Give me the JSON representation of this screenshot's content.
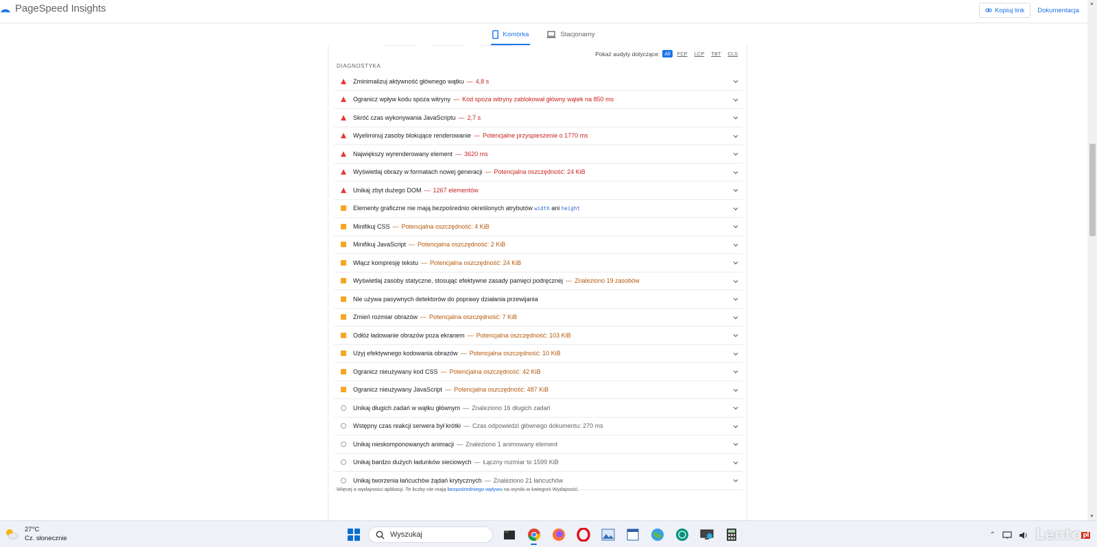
{
  "header": {
    "brand": "PageSpeed Insights",
    "copy_link": "Kopiuj link",
    "docs": "Dokumentacja"
  },
  "device_tabs": [
    {
      "label": "Komórka",
      "active": true
    },
    {
      "label": "Stacjonarny",
      "active": false
    }
  ],
  "filter": {
    "label": "Pokaż audyty dotyczące:",
    "chips": [
      "All",
      "FCP",
      "LCP",
      "TBT",
      "CLS"
    ],
    "active": "All"
  },
  "section_title": "DIAGNOSTYKA",
  "audits": [
    {
      "status": "fail",
      "title": "Zminimalizuj aktywność głównego wątku",
      "value": "4,8 s"
    },
    {
      "status": "fail",
      "title": "Ogranicz wpływ kodu spoza witryny",
      "value": "Kod spoza witryny zablokował główny wątek na 850 ms"
    },
    {
      "status": "fail",
      "title": "Skróć czas wykonywania JavaScriptu",
      "value": "2,7 s"
    },
    {
      "status": "fail",
      "title": "Wyeliminuj zasoby blokujące renderowanie",
      "value": "Potencjalne przyspieszenie o 1770 ms"
    },
    {
      "status": "fail",
      "title": "Największy wyrenderowany element",
      "value": "3620 ms"
    },
    {
      "status": "fail",
      "title": "Wyświetlaj obrazy w formatach nowej generacji",
      "value": "Potencjalna oszczędność: 24 KiB"
    },
    {
      "status": "fail",
      "title": "Unikaj zbyt dużego DOM",
      "value": "1267 elementów"
    },
    {
      "status": "avg",
      "title": "Elementy graficzne nie mają bezpośrednio określonych atrybutów",
      "code1": "width",
      "conj": "ani",
      "code2": "height"
    },
    {
      "status": "avg",
      "title": "Minifikuj CSS",
      "value": "Potencjalna oszczędność: 4 KiB"
    },
    {
      "status": "avg",
      "title": "Minifikuj JavaScript",
      "value": "Potencjalna oszczędność: 2 KiB"
    },
    {
      "status": "avg",
      "title": "Włącz kompresję tekstu",
      "value": "Potencjalna oszczędność: 24 KiB"
    },
    {
      "status": "avg",
      "title": "Wyświetlaj zasoby statyczne, stosując efektywne zasady pamięci podręcznej",
      "value": "Znaleziono 19 zasobów"
    },
    {
      "status": "avg",
      "title": "Nie używa pasywnych detektorów do poprawy działania przewijania"
    },
    {
      "status": "avg",
      "title": "Zmień rozmiar obrazów",
      "value": "Potencjalna oszczędność: 7 KiB"
    },
    {
      "status": "avg",
      "title": "Odłóż ładowanie obrazów poza ekranem",
      "value": "Potencjalna oszczędność: 103 KiB"
    },
    {
      "status": "avg",
      "title": "Użyj efektywnego kodowania obrazów",
      "value": "Potencjalna oszczędność: 10 KiB"
    },
    {
      "status": "avg",
      "title": "Ogranicz nieużywany kod CSS",
      "value": "Potencjalna oszczędność: 42 KiB"
    },
    {
      "status": "avg",
      "title": "Ogranicz nieużywany JavaScript",
      "value": "Potencjalna oszczędność: 487 KiB"
    },
    {
      "status": "pass",
      "title": "Unikaj długich zadań w wątku głównym",
      "value": "Znaleziono 16 długich zadań"
    },
    {
      "status": "pass",
      "title": "Wstępny czas reakcji serwera był krótki",
      "value": "Czas odpowiedzi głównego dokumentu: 270 ms"
    },
    {
      "status": "pass",
      "title": "Unikaj nieskomponowanych animacji",
      "value": "Znaleziono 1 animowany element"
    },
    {
      "status": "pass",
      "title": "Unikaj bardzo dużych ładunków sieciowych",
      "value": "Łączny rozmiar to 1599 KiB"
    },
    {
      "status": "pass",
      "title": "Unikaj tworzenia łańcuchów żądań krytycznych",
      "value": "Znaleziono 21 łańcuchów"
    }
  ],
  "footnote": {
    "before": "Więcej o wydajności aplikacji. Te liczby nie mają ",
    "link": "bezpośredniego wpływu",
    "after": " na wyniki w kategorii Wydajność."
  },
  "taskbar": {
    "temperature": "27°C",
    "weather": "Cz. słonecznie",
    "search_placeholder": "Wyszukaj",
    "apps": [
      "file-explorer-icon",
      "chrome-icon",
      "firefox-icon",
      "opera-icon",
      "photos-icon",
      "app-icon",
      "globe-icon",
      "teal-app-icon",
      "remote-desktop-icon",
      "calculator-icon"
    ],
    "watermark": "Lento",
    "watermark_badge": "pl"
  },
  "colors": {
    "accent": "#1a73e8",
    "fail": "#e53935",
    "average": "#f5a623",
    "pass_ring": "#9e9e9e"
  }
}
